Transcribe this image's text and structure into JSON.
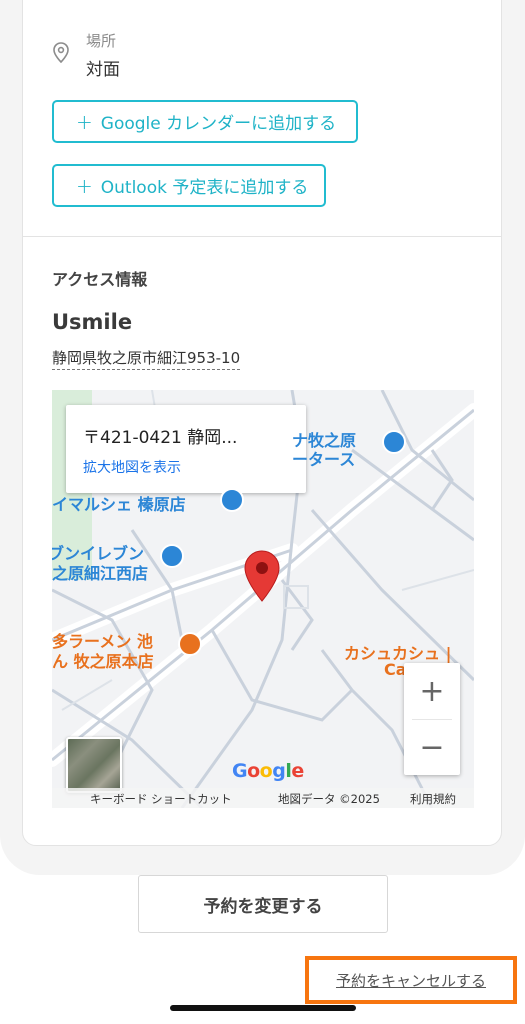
{
  "location": {
    "label": "場所",
    "value": "対面"
  },
  "calendar_buttons": {
    "google": {
      "plus": "+",
      "label": "Google カレンダーに追加する"
    },
    "outlook": {
      "plus": "+",
      "label": "Outlook 予定表に追加する"
    }
  },
  "access": {
    "heading": "アクセス情報",
    "store_name": "Usmile",
    "address": "静岡県牧之原市細江953-10"
  },
  "map": {
    "info_address": "〒421-0421 静岡...",
    "info_link": "拡大地図を表示",
    "pois": {
      "p1": "ナ牧之原",
      "p1b": "ータース",
      "p2": "イマルシェ 榛原店",
      "p3": "ブンイレブン",
      "p3b": "之原細江西店",
      "p4": "多ラーメン 池",
      "p4b": "ん 牧之原本店",
      "p5": "カシュカシュ |",
      "p5b": "Ca"
    },
    "zoom_in": "+",
    "zoom_out": "−",
    "logo": "Google",
    "footer": {
      "shortcuts": "キーボード ショートカット",
      "data": "地図データ ©2025",
      "terms": "利用規約"
    },
    "colors": {
      "pin": "#e53935",
      "poi_blue": "#2c86d6",
      "poi_orange": "#e8711e",
      "road": "#c9d1dc"
    }
  },
  "actions": {
    "change": "予約を変更する",
    "cancel": "予約をキャンセルする"
  },
  "colors": {
    "accent": "#21bcd0",
    "highlight": "#f7750f"
  }
}
